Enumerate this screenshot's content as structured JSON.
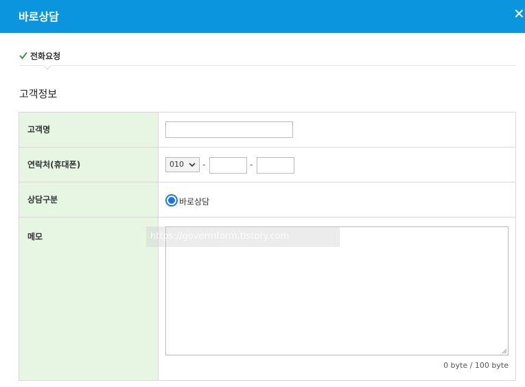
{
  "header": {
    "title": "바로상담",
    "close_icon": "close-icon"
  },
  "tab": {
    "label": "전화요청",
    "icon": "check-icon",
    "icon_color": "#2e9e3e"
  },
  "section": {
    "title": "고객정보"
  },
  "form": {
    "name": {
      "label": "고객명",
      "value": ""
    },
    "phone": {
      "label": "연락처(휴대폰)",
      "prefix": "010",
      "prefix_options": [
        "010"
      ],
      "separator": "-",
      "middle": "",
      "last": ""
    },
    "consult_type": {
      "label": "상담구분",
      "option_label": "바로상담",
      "selected": true
    },
    "memo": {
      "label": "메모",
      "value": "",
      "byte_count": "0 byte / 100 byte"
    }
  },
  "watermark": {
    "text": "https://govermform.tistory.com"
  },
  "colors": {
    "header": "#0b95de",
    "label_bg": "#e6f6e3",
    "radio": "#1a73e8"
  }
}
